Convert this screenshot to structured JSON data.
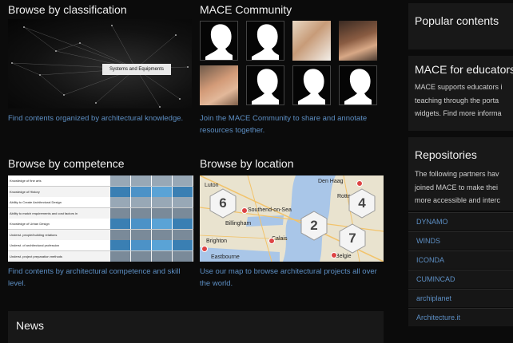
{
  "classification": {
    "heading": "Browse by classification",
    "graph_label": "Systems and Equipments",
    "caption": "Find contents organized by architectural knowledge."
  },
  "community": {
    "heading": "MACE Community",
    "caption_line1": "Join the MACE Community to share and annotate",
    "caption_line2": "resources together."
  },
  "competence": {
    "heading": "Browse by competence",
    "rows": [
      {
        "label": "Knowledge of fine arts",
        "values": [
          "",
          "",
          "",
          ""
        ]
      },
      {
        "label": "Knowledge of History",
        "values": [
          "",
          "",
          "",
          ""
        ]
      },
      {
        "label": "Ability to Create Architectural Design",
        "values": [
          "",
          "",
          "",
          ""
        ]
      },
      {
        "label": "Ability to match requirements and cost factors in",
        "values": [
          "",
          "",
          "",
          ""
        ]
      },
      {
        "label": "Knowledge of Urban Design",
        "values": [
          "",
          "",
          "",
          ""
        ]
      },
      {
        "label": "Underst. people/building relations",
        "values": [
          "",
          "",
          "",
          ""
        ]
      },
      {
        "label": "Underst. of architectural profession",
        "values": [
          "",
          "",
          "",
          ""
        ]
      },
      {
        "label": "Underst. project preparation methods",
        "values": [
          "",
          "",
          "",
          ""
        ]
      }
    ],
    "caption_line1": "Find contents by architectural competence and skill",
    "caption_line2": "level."
  },
  "location": {
    "heading": "Browse by location",
    "clusters": [
      "6",
      "4",
      "2",
      "7"
    ],
    "places": [
      "Luton",
      "Den Haag",
      "Rotte",
      "Southend-on-Sea",
      "Billingham",
      "Brighton",
      "Calais",
      "Eastbourne",
      "Belgie"
    ],
    "caption_line1": "Use our map to browse architectural projects all over",
    "caption_line2": "the world."
  },
  "news": {
    "heading": "News"
  },
  "sidebar": {
    "popular": {
      "heading": "Popular contents"
    },
    "educators": {
      "heading": "MACE for educators",
      "lines": [
        "MACE supports educators i",
        "teaching through the porta",
        "widgets. Find more informa"
      ]
    },
    "repositories": {
      "heading": "Repositories",
      "lines": [
        "The following partners hav",
        "joined MACE to make thei",
        "more accessible and interc"
      ],
      "items": [
        "DYNAMO",
        "WINDS",
        "ICONDA",
        "CUMINCAD",
        "archiplanet",
        "Architecture.it"
      ]
    }
  },
  "colors": {
    "link": "#5d8fc4",
    "panel": "#181818",
    "background": "#0b0b0b"
  }
}
